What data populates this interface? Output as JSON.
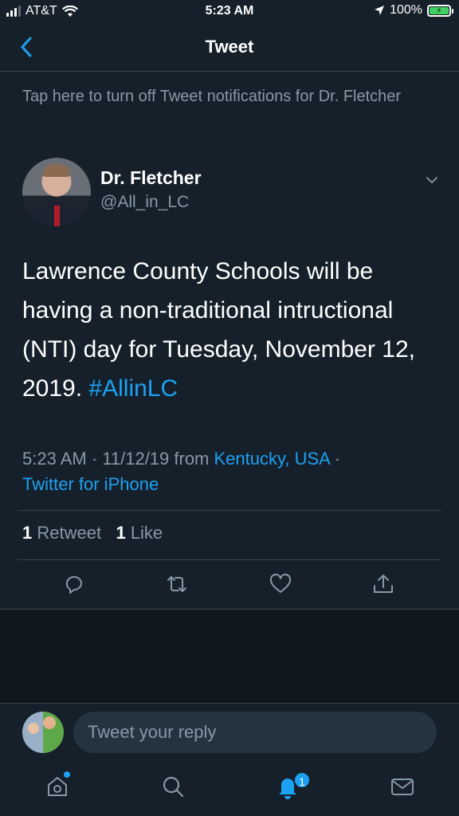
{
  "status_bar": {
    "carrier": "AT&T",
    "time": "5:23 AM",
    "battery": "100%",
    "battery_level": 1.0
  },
  "nav": {
    "title": "Tweet"
  },
  "notification_text": "Tap here to turn off Tweet notifications for Dr. Fletcher",
  "author": {
    "name": "Dr. Fletcher",
    "handle": "@All_in_LC"
  },
  "tweet": {
    "text": "Lawrence County Schools will be having a non-traditional intructional (NTI) day for Tuesday, November 12, 2019. ",
    "hashtag": "#AllinLC",
    "time": "5:23 AM · 11/12/19 from ",
    "location": "Kentucky, USA",
    "separator": " ·",
    "source": "Twitter for iPhone"
  },
  "stats": {
    "retweets": "1",
    "retweets_label": "Retweet",
    "likes": "1",
    "likes_label": "Like"
  },
  "reply": {
    "placeholder": "Tweet your reply"
  },
  "tabs": {
    "notifications_badge": "1"
  },
  "colors": {
    "background": "#15202b",
    "accent": "#1da1f2",
    "secondary_text": "#8899a6",
    "divider": "#38444d"
  },
  "icons": [
    "back-arrow-icon",
    "chevron-down-icon",
    "reply-icon",
    "retweet-icon",
    "like-icon",
    "share-icon",
    "home-icon",
    "search-icon",
    "notifications-icon",
    "messages-icon"
  ]
}
